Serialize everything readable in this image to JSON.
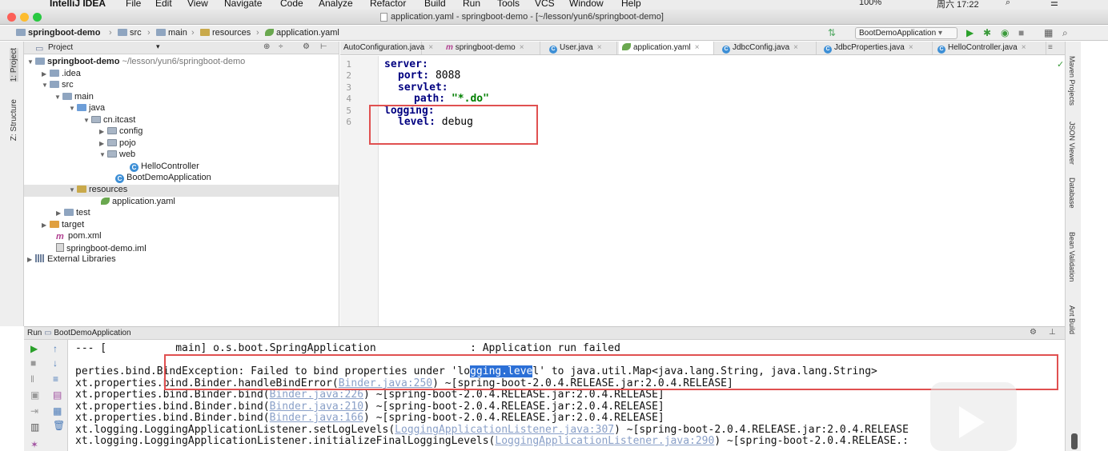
{
  "menubar": {
    "apple": "",
    "items": [
      "IntelliJ IDEA",
      "File",
      "Edit",
      "View",
      "Navigate",
      "Code",
      "Analyze",
      "Refactor",
      "Build",
      "Run",
      "Tools",
      "VCS",
      "Window",
      "Help"
    ],
    "battery": "100%",
    "clock": "周六 17:22"
  },
  "window": {
    "title": "application.yaml - springboot-demo - [~/lesson/yun6/springboot-demo]"
  },
  "navbar": {
    "breadcrumbs": [
      "springboot-demo",
      "src",
      "main",
      "resources",
      "application.yaml"
    ],
    "run_config": "BootDemoApplication"
  },
  "left_stripe": {
    "project_label": "1: Project",
    "structure_label": "Z: Structure"
  },
  "project_panel": {
    "header": "Project",
    "tree": [
      {
        "label": "springboot-demo",
        "extra": "~/lesson/yun6/springboot-demo"
      },
      {
        "label": ".idea"
      },
      {
        "label": "src"
      },
      {
        "label": "main"
      },
      {
        "label": "java"
      },
      {
        "label": "cn.itcast"
      },
      {
        "label": "config"
      },
      {
        "label": "pojo"
      },
      {
        "label": "web"
      },
      {
        "label": "HelloController"
      },
      {
        "label": "BootDemoApplication"
      },
      {
        "label": "resources"
      },
      {
        "label": "application.yaml"
      },
      {
        "label": "test"
      },
      {
        "label": "target"
      },
      {
        "label": "pom.xml"
      },
      {
        "label": "springboot-demo.iml"
      },
      {
        "label": "External Libraries"
      }
    ]
  },
  "tabs": [
    {
      "label": "AutoConfiguration.java"
    },
    {
      "label": "springboot-demo"
    },
    {
      "label": "User.java"
    },
    {
      "label": "application.yaml"
    },
    {
      "label": "JdbcConfig.java"
    },
    {
      "label": "JdbcProperties.java"
    },
    {
      "label": "HelloController.java"
    }
  ],
  "editor": {
    "lines": [
      {
        "num": "1",
        "key": "server:",
        "value": ""
      },
      {
        "num": "2",
        "key": "port:",
        "value": " 8088"
      },
      {
        "num": "3",
        "key": "servlet:",
        "value": ""
      },
      {
        "num": "4",
        "key": "path:",
        "value": " \"*.do\""
      },
      {
        "num": "5",
        "key": "logging:",
        "value": ""
      },
      {
        "num": "6",
        "key": "level:",
        "value": " debug"
      }
    ]
  },
  "right_stripe": [
    "Maven Projects",
    "JSON Viewer",
    "Database",
    "Bean Validation",
    "Ant Build"
  ],
  "run_panel": {
    "label": "Run",
    "config": "BootDemoApplication",
    "lines": [
      {
        "a": "--- [           main] o.s.boot.SpringApplication               : Application run failed"
      },
      {
        "a": "perties.bind.BindException: Failed to bind properties under 'lo",
        "sel": "gging.leve",
        "b": "l' to java.util.Map<java.lang.String, java.lang.String>"
      },
      {
        "a": "xt.properties.bind.Binder.handleBindError(",
        "link": "Binder.java:250",
        "b": ") ~[spring-boot-2.0.4.RELEASE.jar:2.0.4.RELEASE]"
      },
      {
        "a": "xt.properties.bind.Binder.bind(",
        "link": "Binder.java:226",
        "b": ") ~[spring-boot-2.0.4.RELEASE.jar:2.0.4.RELEASE]"
      },
      {
        "a": "xt.properties.bind.Binder.bind(",
        "link": "Binder.java:210",
        "b": ") ~[spring-boot-2.0.4.RELEASE.jar:2.0.4.RELEASE]"
      },
      {
        "a": "xt.properties.bind.Binder.bind(",
        "link": "Binder.java:166",
        "b": ") ~[spring-boot-2.0.4.RELEASE.jar:2.0.4.RELEASE]"
      },
      {
        "a": "xt.logging.LoggingApplicationListener.setLogLevels(",
        "link": "LoggingApplicationListener.java:307",
        "b": ") ~[spring-boot-2.0.4.RELEASE.jar:2.0.4.RELEASE"
      },
      {
        "a": "xt.logging.LoggingApplicationListener.initializeFinalLoggingLevels(",
        "link": "LoggingApplicationListener.java:290",
        "b": ") ~[spring-boot-2.0.4.RELEASE.:"
      }
    ]
  },
  "colors": {
    "highlight_box": "#e05050",
    "yaml_key": "#000080",
    "selection": "#2b6fd6"
  }
}
